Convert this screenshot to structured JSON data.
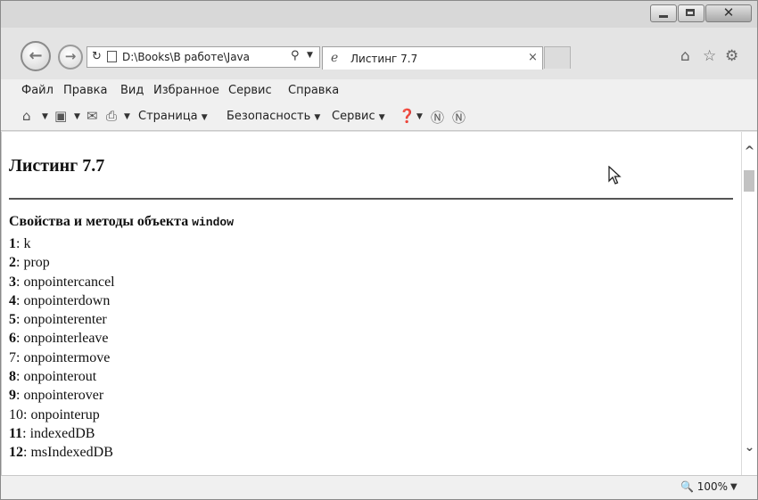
{
  "window": {
    "controls": {
      "minimize": "",
      "maximize": "",
      "close": "✕"
    }
  },
  "navigation": {
    "back_icon": "back-arrow-icon",
    "forward_icon": "forward-arrow-icon",
    "address": "D:\\Books\\В работе\\Java",
    "refresh_icon": "refresh-icon",
    "search_icon": "search-icon"
  },
  "tab": {
    "title": "Листинг 7.7",
    "close": "×"
  },
  "right_icons": [
    "home-icon",
    "favorites-star-icon",
    "settings-gear-icon"
  ],
  "menu": {
    "items": [
      "Файл",
      "Правка",
      "Вид",
      "Избранное",
      "Сервис",
      "Справка"
    ]
  },
  "commandbar": {
    "page_label": "Страница",
    "security_label": "Безопасность",
    "service_label": "Сервис"
  },
  "page": {
    "title": "Листинг 7.7",
    "subhead_text": "Свойства и методы объекта ",
    "subhead_code": "window",
    "properties": [
      {
        "num": "1",
        "name": "k",
        "bold": true
      },
      {
        "num": "2",
        "name": "prop",
        "bold": true
      },
      {
        "num": "3",
        "name": "onpointercancel",
        "bold": true
      },
      {
        "num": "4",
        "name": "onpointerdown",
        "bold": true
      },
      {
        "num": "5",
        "name": "onpointerenter",
        "bold": true
      },
      {
        "num": "6",
        "name": "onpointerleave",
        "bold": true
      },
      {
        "num": "7",
        "name": "onpointermove",
        "bold": false
      },
      {
        "num": "8",
        "name": "onpointerout",
        "bold": true
      },
      {
        "num": "9",
        "name": "onpointerover",
        "bold": true
      },
      {
        "num": "10",
        "name": "onpointerup",
        "bold": false
      },
      {
        "num": "11",
        "name": "indexedDB",
        "bold": true
      },
      {
        "num": "12",
        "name": "msIndexedDB",
        "bold": true
      }
    ]
  },
  "status": {
    "zoom": "100%"
  }
}
